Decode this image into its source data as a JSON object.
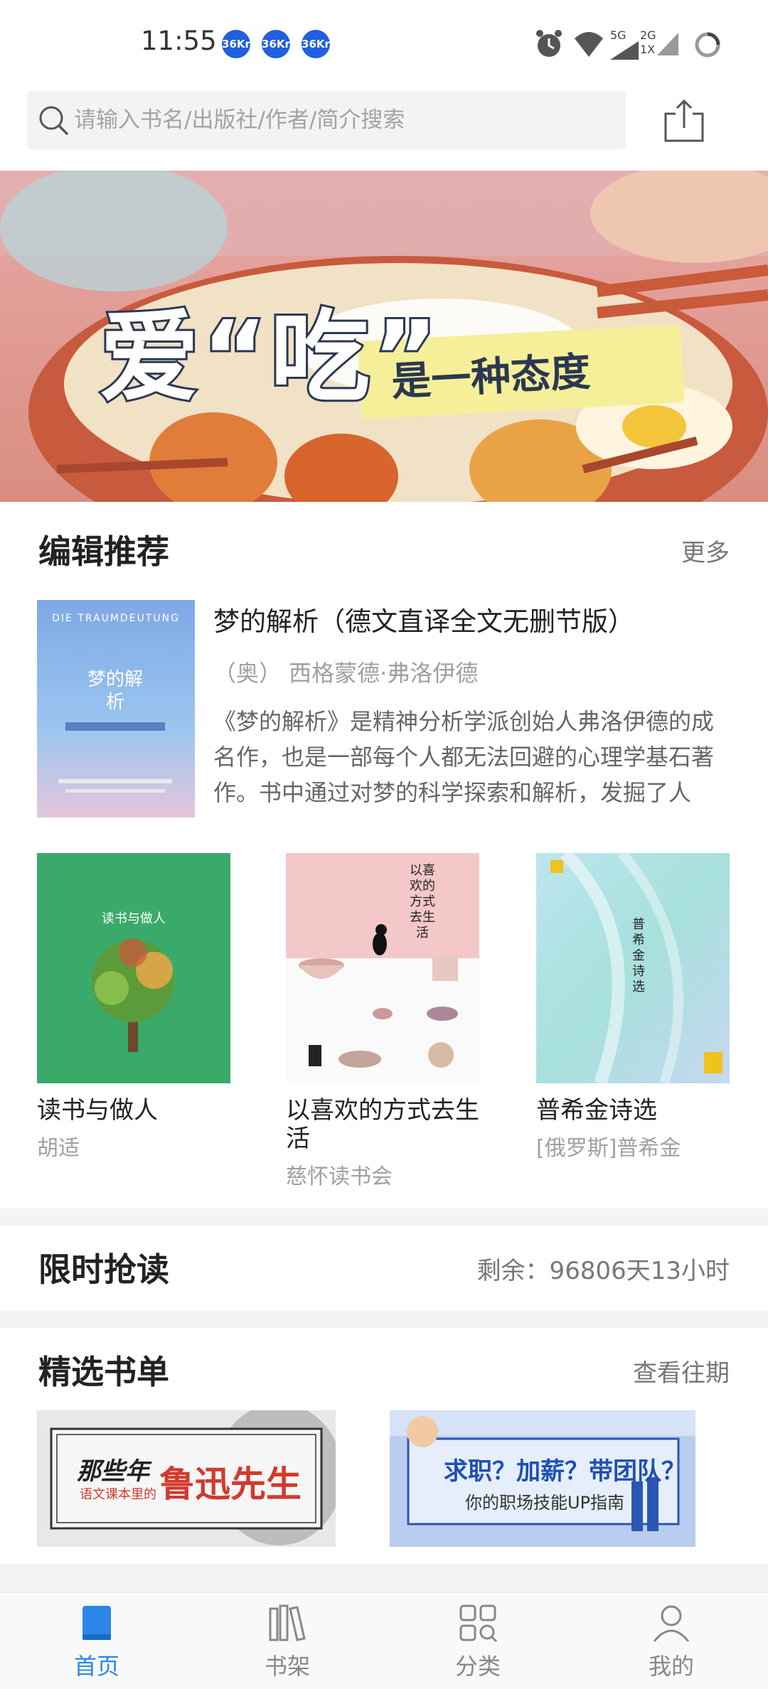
{
  "status_bar": {
    "time": "11:55",
    "badges": [
      "36Kr",
      "36Kr",
      "36Kr"
    ],
    "network_5g": "5G",
    "network_2g": "2G",
    "network_1x": "1X"
  },
  "search": {
    "placeholder": "请输入书名/出版社/作者/简介搜索"
  },
  "banner": {
    "title": "爱“吃”",
    "subtitle": "是一种态度"
  },
  "editor_picks": {
    "title": "编辑推荐",
    "more": "更多",
    "featured": {
      "title": "梦的解析（德文直译全文无删节版）",
      "author": "（奥） 西格蒙德·弗洛伊德",
      "description": "《梦的解析》是精神分析学派创始人弗洛伊德的成名作，也是一部每个人都无法回避的心理学基石著作。书中通过对梦的科学探索和解析，发掘了人性…",
      "cover_text_top": "DIE TRAUMDEUTUNG",
      "cover_text_title": "梦的解析"
    },
    "books": [
      {
        "title": "读书与做人",
        "author": "胡适",
        "cover_text": "读书与做人"
      },
      {
        "title": "以喜欢的方式去生活",
        "author": "慈怀读书会",
        "cover_text": "以喜欢的方式去生活"
      },
      {
        "title": "普希金诗选",
        "author": "[俄罗斯]普希金",
        "cover_text": "普希金诗选"
      }
    ]
  },
  "flash_read": {
    "title": "限时抢读",
    "remaining": "剩余：96806天13小时"
  },
  "booklists": {
    "title": "精选书单",
    "more": "查看往期",
    "items": [
      {
        "line1": "那些年",
        "line2": "语文课本里的",
        "line3": "鲁迅先生"
      },
      {
        "line1": "求职？加薪？带团队？",
        "line2": "你的职场技能UP指南"
      }
    ]
  },
  "bottom_nav": {
    "items": [
      {
        "label": "首页",
        "active": true
      },
      {
        "label": "书架",
        "active": false
      },
      {
        "label": "分类",
        "active": false
      },
      {
        "label": "我的",
        "active": false
      }
    ]
  },
  "colors": {
    "accent": "#2d87e8",
    "divider": "#f3f4f6"
  }
}
